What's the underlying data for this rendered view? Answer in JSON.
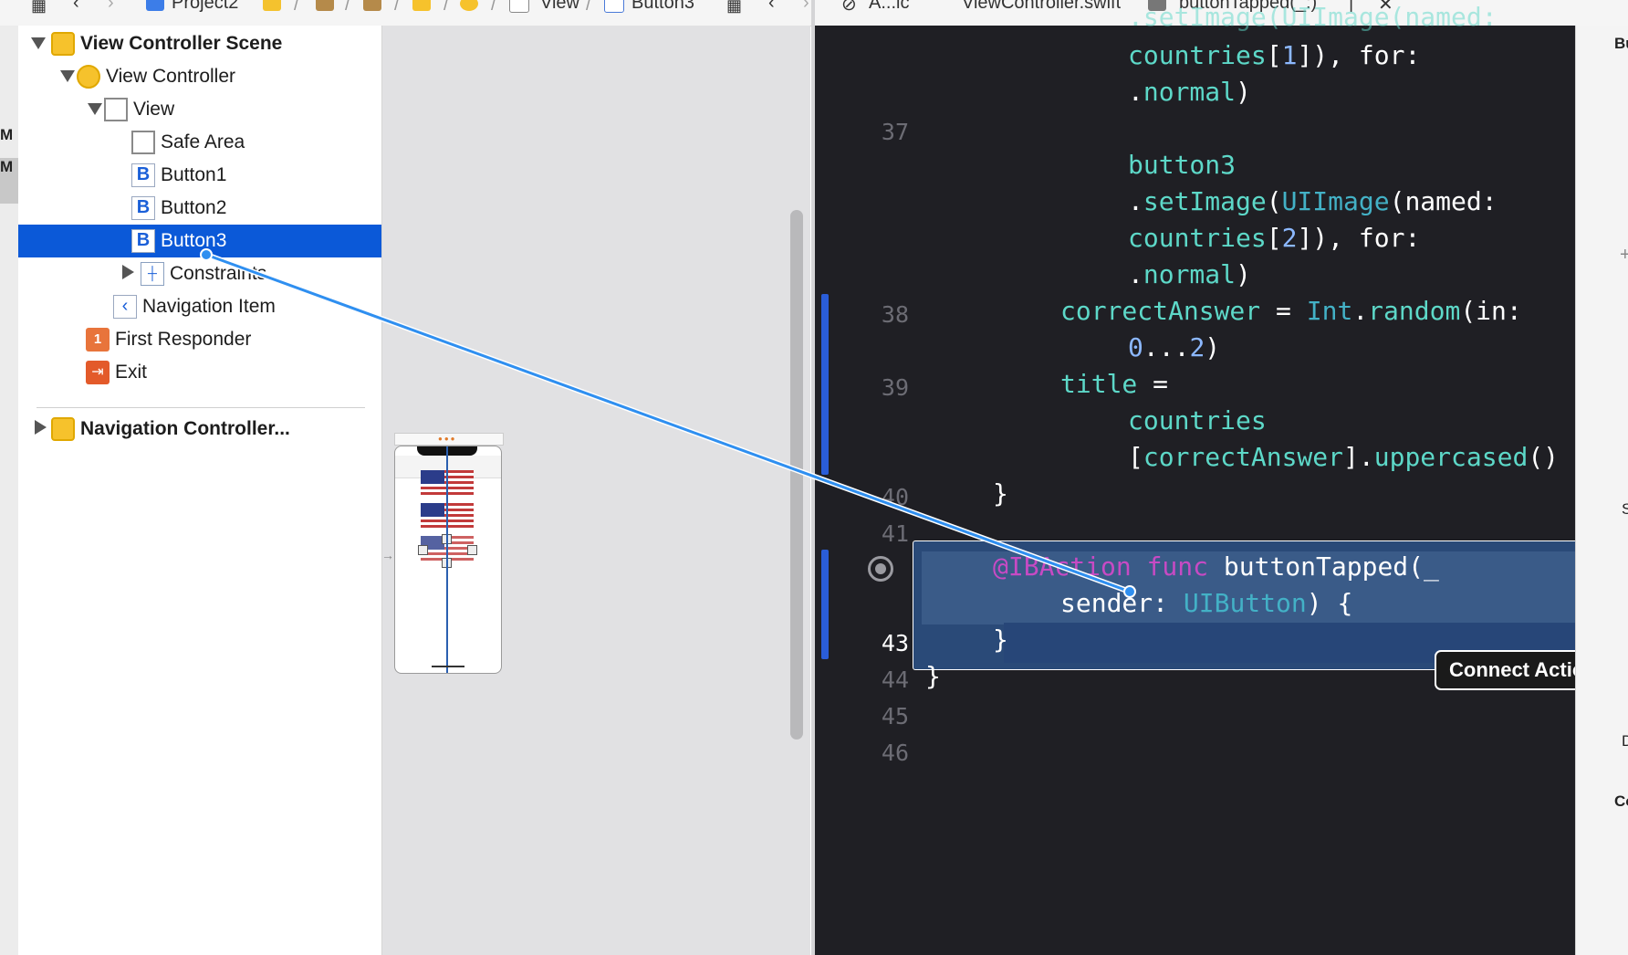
{
  "jumpbar_left": {
    "items": [
      "Project2",
      "View",
      "Button3"
    ]
  },
  "jumpbar_right": {
    "items": [
      "A...ic",
      "ViewController.swift",
      "buttonTapped(_:)"
    ]
  },
  "left_strip": {
    "letters": [
      "M",
      "M"
    ]
  },
  "outline": {
    "scene_title": "View Controller Scene",
    "view_controller": "View Controller",
    "view": "View",
    "safe_area": "Safe Area",
    "button1": "Button1",
    "button2": "Button2",
    "button3": "Button3",
    "constraints": "Constraints",
    "navigation_item": "Navigation Item",
    "first_responder": "First Responder",
    "exit": "Exit",
    "navigation_controller": "Navigation Controller...",
    "icon_letter_b": "B",
    "first_responder_glyph": "1",
    "selected_item": "Button3"
  },
  "editor": {
    "line_numbers": [
      "37",
      "38",
      "39",
      "40",
      "41",
      "43",
      "44",
      "45",
      "46"
    ],
    "current_line": "43",
    "code": {
      "l0": ".setImage(UIImage(named:",
      "l1_a": "countries",
      "l1_b": "[",
      "l1_c": "1",
      "l1_d": "]), for:",
      "l2_a": ".",
      "l2_b": "normal",
      "l2_c": ")",
      "l3": "button3",
      "l4_a": ".",
      "l4_b": "setImage",
      "l4_c": "(",
      "l4_d": "UIImage",
      "l4_e": "(named:",
      "l5_a": "countries",
      "l5_b": "[",
      "l5_c": "2",
      "l5_d": "]), for:",
      "l6_a": ".",
      "l6_b": "normal",
      "l6_c": ")",
      "l7_a": "correctAnswer",
      "l7_b": " = ",
      "l7_c": "Int",
      "l7_d": ".",
      "l7_e": "random",
      "l7_f": "(in:",
      "l8_a": "0",
      "l8_b": "...",
      "l8_c": "2",
      "l8_d": ")",
      "l9_a": "title",
      "l9_b": " =",
      "l10": "countries",
      "l11_a": "[",
      "l11_b": "correctAnswer",
      "l11_c": "].",
      "l11_d": "uppercased",
      "l11_e": "()",
      "l12": "}",
      "l13_a": "@IBAction",
      "l13_b": " func ",
      "l13_c": "buttonTapped",
      "l13_d": "(_",
      "l14_a": "sender",
      "l14_b": ": ",
      "l14_c": "UIButton",
      "l14_d": ") {",
      "l15": "}",
      "l16": "}"
    }
  },
  "tooltip": {
    "text": "Connect Action"
  },
  "inspector": {
    "labels": [
      "Bu",
      "+",
      "S",
      "D",
      "Co"
    ]
  },
  "colors": {
    "selection": "#0b59d8",
    "connection_line": "#2f8ff0",
    "editor_bg": "#1f1f24"
  }
}
